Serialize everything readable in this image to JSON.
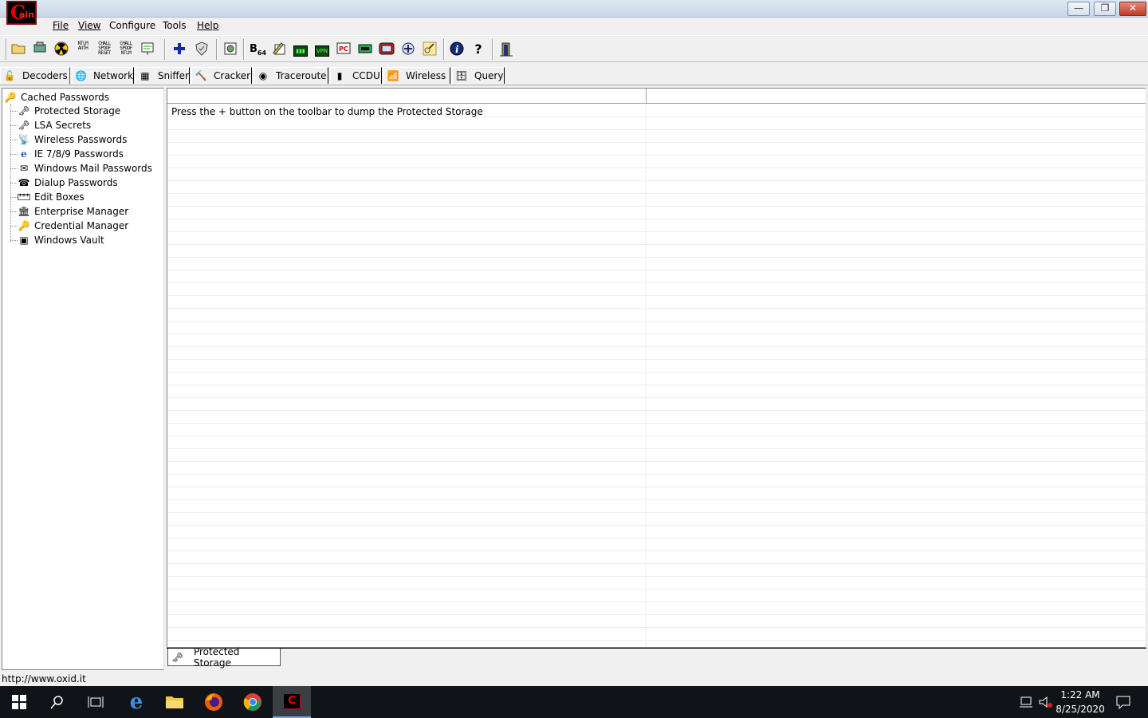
{
  "window": {
    "logo_text": "Cain",
    "controls": {
      "minimize": "—",
      "restore": "❐",
      "close": "✕"
    }
  },
  "menu": [
    {
      "label": "File"
    },
    {
      "label": "View"
    },
    {
      "label": "Configure"
    },
    {
      "label": "Tools"
    },
    {
      "label": "Help"
    }
  ],
  "toolbar": {
    "icons": [
      "open-folder-icon",
      "network-adapter-icon",
      "radiation-icon",
      "ntlm-auth-icon",
      "chall-spoof-reset-icon",
      "chall-spoof-ntlm-icon",
      "certificate-icon",
      "plus-icon",
      "shield-icon",
      "gear-cert-icon",
      "base64-icon",
      "pen-icon",
      "lcd-icon",
      "vpn-icon",
      "pc-icon",
      "hash-icon",
      "router-icon",
      "cisco-icon",
      "key-icon",
      "info-icon",
      "help-icon",
      "exit-icon"
    ],
    "text": {
      "ntlm": "NTLM\nAUTH",
      "reset": "CHALL\nSPOOF\nRESET",
      "chall": "CHALL\nSPOOF\nNTLM",
      "b64": "B64",
      "vpn": "VPN",
      "pc": "PC"
    }
  },
  "tabs": [
    {
      "label": "Decoders",
      "icon": "decoders-icon"
    },
    {
      "label": "Network",
      "icon": "network-icon"
    },
    {
      "label": "Sniffer",
      "icon": "sniffer-icon"
    },
    {
      "label": "Cracker",
      "icon": "cracker-icon"
    },
    {
      "label": "Traceroute",
      "icon": "traceroute-icon"
    },
    {
      "label": "CCDU",
      "icon": "ccdu-icon"
    },
    {
      "label": "Wireless",
      "icon": "wireless-icon"
    },
    {
      "label": "Query",
      "icon": "query-icon"
    }
  ],
  "tree": {
    "root": "Cached Passwords",
    "items": [
      "Protected Storage",
      "LSA Secrets",
      "Wireless Passwords",
      "IE 7/8/9 Passwords",
      "Windows Mail Passwords",
      "Dialup Passwords",
      "Edit Boxes",
      "Enterprise Manager",
      "Credential Manager",
      "Windows Vault"
    ]
  },
  "list": {
    "message": "Press the + button on the toolbar to dump the Protected Storage"
  },
  "bottom_tab": {
    "label": "Protected Storage"
  },
  "status": {
    "url": "http://www.oxid.it"
  },
  "taskbar": {
    "time": "1:22 AM",
    "date": "8/25/2020"
  }
}
